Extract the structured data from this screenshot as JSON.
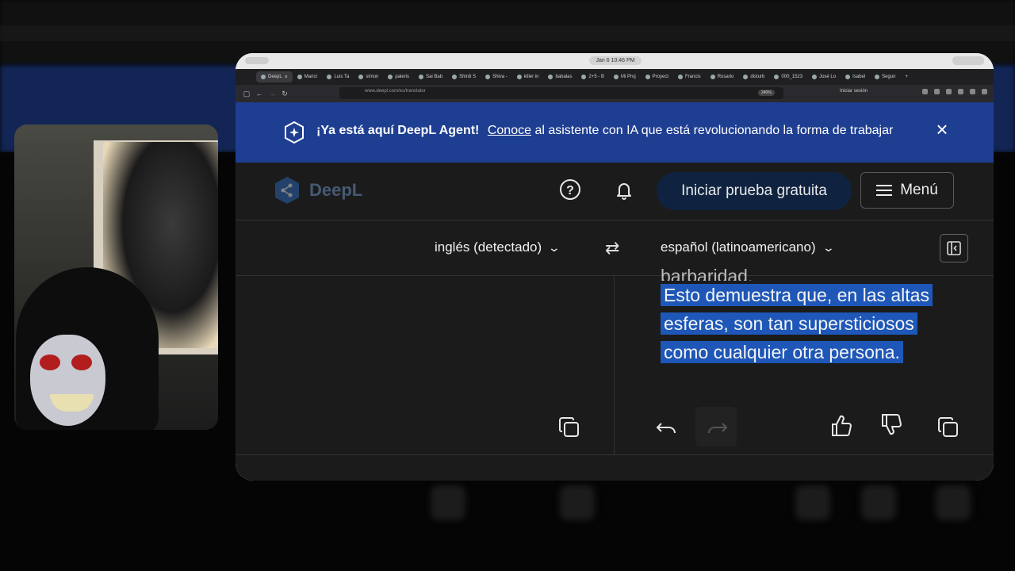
{
  "browser": {
    "clock": "Jan 6 10:46 PM",
    "tabs": [
      {
        "label": "DeepL",
        "active": true
      },
      {
        "label": "Maricr"
      },
      {
        "label": "Luis Ta"
      },
      {
        "label": "simon"
      },
      {
        "label": "paleris"
      },
      {
        "label": "Sai Bab"
      },
      {
        "label": "Shirdi S"
      },
      {
        "label": "Shiva -"
      },
      {
        "label": "killer in"
      },
      {
        "label": "babalas"
      },
      {
        "label": "2+5 - B"
      },
      {
        "label": "Mi Proj"
      },
      {
        "label": "Proyect"
      },
      {
        "label": "Francis"
      },
      {
        "label": "Rosario"
      },
      {
        "label": "disturb"
      },
      {
        "label": "000_1523"
      },
      {
        "label": "José Lo"
      },
      {
        "label": "Isabel"
      },
      {
        "label": "Segun"
      }
    ],
    "url": "www.deepl.com/es/translator",
    "zoom": "240%",
    "signin": "Iniciar sesión"
  },
  "promo": {
    "title": "¡Ya está aquí DeepL Agent!",
    "link": "Conoce",
    "text": "al asistente con IA que está revolucionando la forma de trabajar"
  },
  "header": {
    "logo": "DeepL",
    "trial_button": "Iniciar prueba gratuita",
    "menu_button": "Menú"
  },
  "languages": {
    "source": "inglés (detectado)",
    "target": "español (latinoamericano)"
  },
  "translation": {
    "partial_line": "barbaridad.",
    "highlighted_lines": [
      "Esto demuestra que, en las altas",
      "esferas, son tan supersticiosos",
      "como cualquier otra persona."
    ]
  }
}
